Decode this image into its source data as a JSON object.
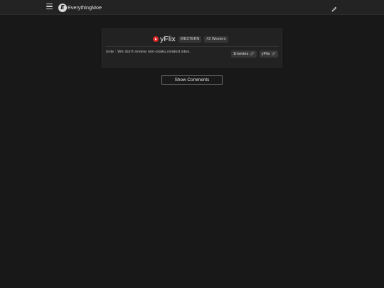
{
  "header": {
    "brand_name": "EverythingMoe",
    "logo_letter": "E",
    "menu_icon": "hamburger-menu-icon",
    "edit_icon": "pencil-icon"
  },
  "site_card": {
    "title": "yFlix",
    "site_icon": "youtube-play-icon",
    "badges": [
      "WESTERN",
      "#2 Western"
    ],
    "note": "note : We don't review non-otaku related sites.",
    "links": [
      {
        "label": "1movies",
        "icon": "link-icon"
      },
      {
        "label": "yFlix",
        "icon": "link-icon"
      }
    ]
  },
  "comments": {
    "button_label": "Show Comments"
  },
  "colors": {
    "background": "#181818",
    "header": "#232323",
    "card": "#222222",
    "accent_red": "#e02828"
  }
}
